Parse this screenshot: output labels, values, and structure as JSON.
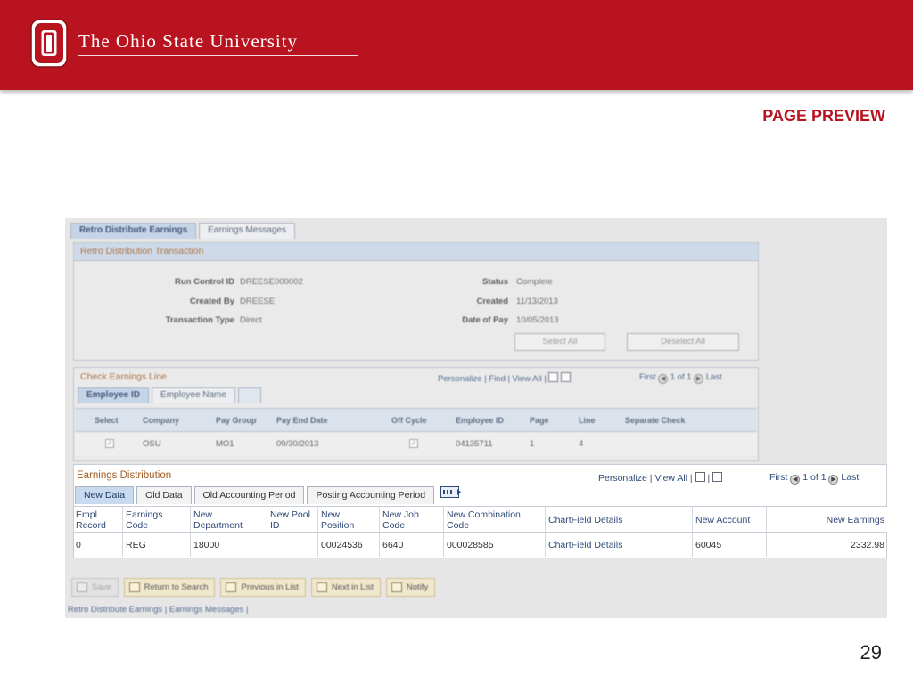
{
  "slide": {
    "brand": "The Ohio State University",
    "heading": "PAGE PREVIEW",
    "page_number": "29",
    "brand_color": "#b8131f"
  },
  "tabs_top": [
    "Retro Distribute Earnings",
    "Earnings Messages"
  ],
  "transaction": {
    "title": "Retro Distribution Transaction",
    "run_control_label": "Run Control ID",
    "run_control_value": "DREESE000002",
    "created_by_label": "Created By",
    "created_by_value": "DREESE",
    "transaction_type_label": "Transaction Type",
    "transaction_type_value": "Direct",
    "status_label": "Status",
    "status_value": "Complete",
    "created_label": "Created",
    "created_value": "11/13/2013",
    "date_of_pay_label": "Date of Pay",
    "date_of_pay_value": "10/05/2013",
    "select_all": "Select All",
    "deselect_all": "Deselect All"
  },
  "check_line": {
    "title": "Check Earnings Line",
    "personalize": "Personalize",
    "find": "Find",
    "view_all": "View All",
    "first": "First",
    "range": "1 of 1",
    "last": "Last",
    "tabs": [
      "Employee ID",
      "Employee Name"
    ],
    "headers": [
      "Select",
      "Company",
      "Pay Group",
      "Pay End Date",
      "Off Cycle",
      "Employee ID",
      "Page",
      "Line",
      "Separate Check"
    ],
    "row": {
      "company": "OSU",
      "pay_group": "MO1",
      "pay_end_date": "09/30/2013",
      "employee_id": "04135711",
      "page": "1",
      "line": "4"
    }
  },
  "earnings": {
    "title": "Earnings Distribution",
    "personalize": "Personalize",
    "view_all": "View All",
    "first": "First",
    "range": "1 of 1",
    "last": "Last",
    "tabs": [
      "New Data",
      "Old Data",
      "Old Accounting Period",
      "Posting Accounting Period"
    ],
    "headers": [
      [
        "Empl",
        "Record"
      ],
      [
        "Earnings",
        "Code"
      ],
      [
        "New",
        "Department"
      ],
      [
        "New Pool",
        "ID"
      ],
      [
        "New",
        "Position"
      ],
      [
        "New Job",
        "Code"
      ],
      [
        "New Combination",
        "Code"
      ],
      [
        "ChartField Details",
        ""
      ],
      [
        "New Account",
        ""
      ],
      [
        "New Earnings",
        ""
      ]
    ],
    "row": {
      "empl_record": "0",
      "earnings_code": "REG",
      "new_department": "18000",
      "new_pool_id": "",
      "new_position": "00024536",
      "new_job_code": "6640",
      "new_combination_code": "000028585",
      "chartfield_details": "ChartField Details",
      "new_account": "60045",
      "new_earnings": "2332.98"
    }
  },
  "toolbar": {
    "save": "Save",
    "return_to_search": "Return to Search",
    "previous_in_list": "Previous in List",
    "next_in_list": "Next in List",
    "notify": "Notify"
  },
  "footer_links": "Retro Distribute Earnings | Earnings Messages |"
}
